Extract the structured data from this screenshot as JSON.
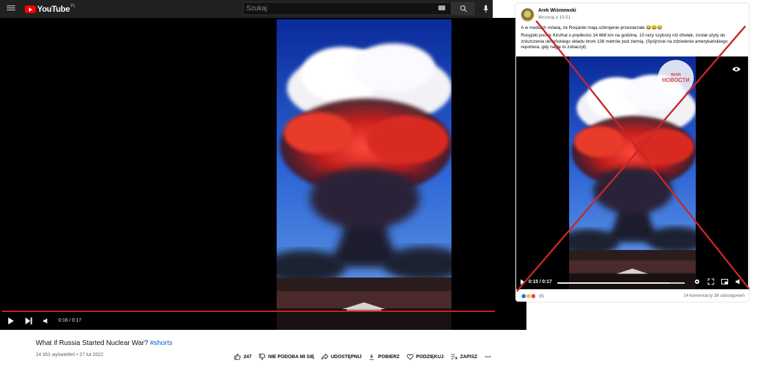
{
  "youtube": {
    "logo_text": "YouTube",
    "logo_country": "PL",
    "search_placeholder": "Szukaj",
    "player_time": "0:16 / 0:17",
    "video_title": "What if Russia Started Nuclear War?",
    "video_hashtag": "#shorts",
    "meta": "14 351 wyświetleń • 27 lut 2022",
    "actions": {
      "like_count": "247",
      "dislike": "NIE PODOBA MI SIĘ",
      "share": "UDOSTĘPNIJ",
      "download": "POBIERZ",
      "thanks": "PODZIĘKUJ",
      "save": "ZAPISZ"
    },
    "progress": 0.94
  },
  "facebook": {
    "author": "Arek Wiśniewski",
    "timestamp": "Wczoraj o 15:51 ·",
    "line1": "A w mediach mówią, że Rosjanie mają uzbrojenie przestarzałe 😂😂😂",
    "line2": "Rosyjski pocisk Kinzhal o prędkości 14 668 km na godzinę, 10 razy szybszy niż dźwięk, został użyty do zniszczenia ukraińskiego składu broni 136 metrów pod ziemią.  (Spójrzcie na zdziwienie amerykańskiego reportera, gdy nagle to zobaczył)",
    "watermark_small": "NEWS",
    "watermark": "НОВОСТИ",
    "video_time": "0:15 / 0:17",
    "reactions_count": "95",
    "stats": "14 komentarzy  38 udostępnień",
    "progress": 0.88
  },
  "colors": {
    "cross": "#c8262a",
    "yt_red": "#ff0000",
    "fb_blue": "#1877f2"
  }
}
